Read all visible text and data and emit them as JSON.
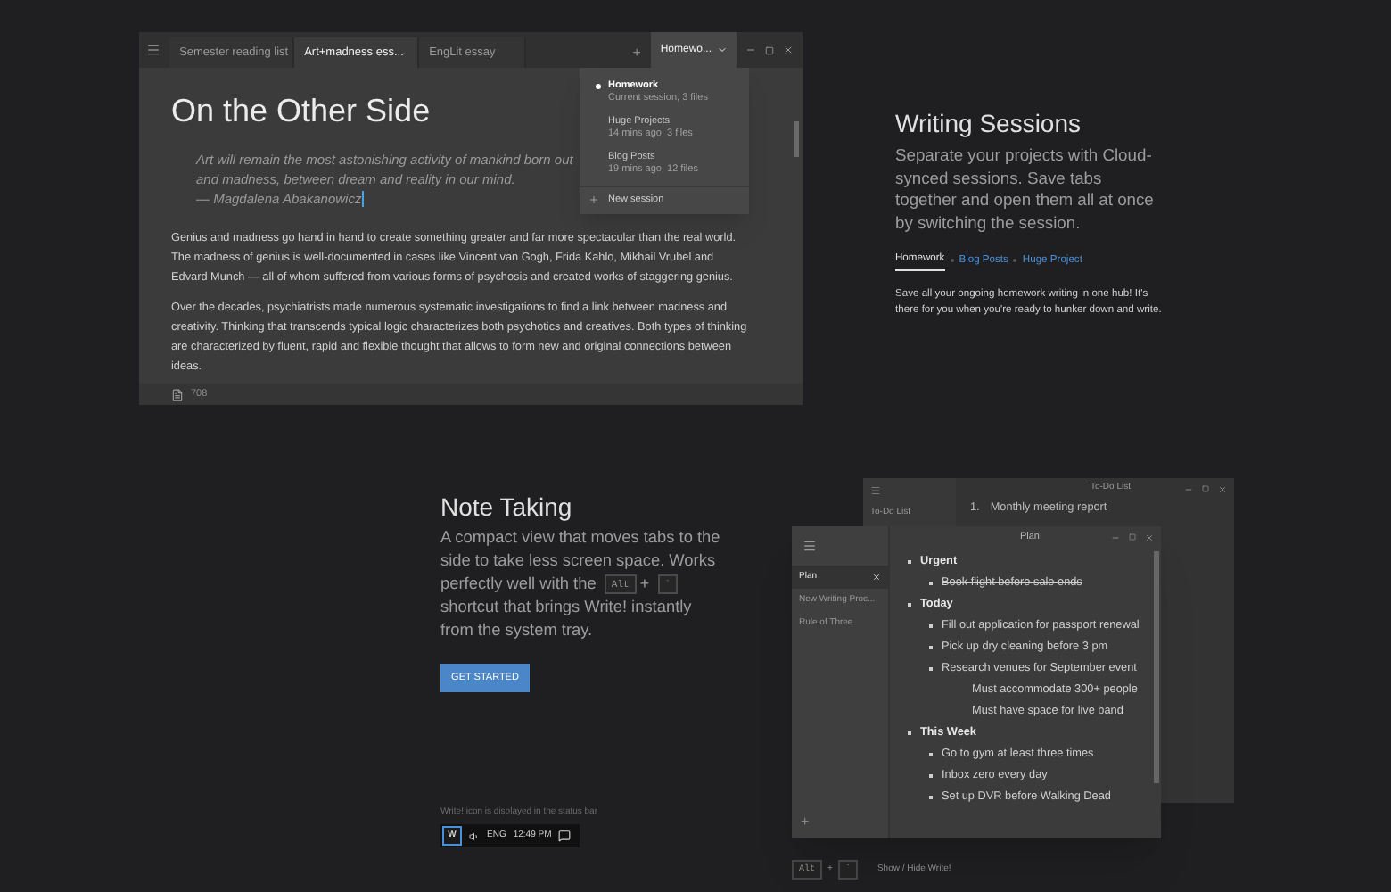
{
  "editor": {
    "tabs": [
      {
        "label": "Semester reading list",
        "selected": false
      },
      {
        "label": "Art+madness ess...",
        "selected": true
      },
      {
        "label": "EngLit essay",
        "selected": false
      }
    ],
    "new_tab": "+",
    "session_button": "Homewo...",
    "session_menu": {
      "items": [
        {
          "name": "Homework",
          "detail": "Current session, 3 files",
          "selected": true
        },
        {
          "name": "Huge Projects",
          "detail": "14 mins ago, 3 files",
          "selected": false
        },
        {
          "name": "Blog Posts",
          "detail": "19 mins ago, 12 files",
          "selected": false
        }
      ],
      "new_session": "New session"
    },
    "document": {
      "title": "On the Other Side",
      "quote_lines": [
        "Art will remain the most astonishing activity of mankind born out",
        "and madness, between dream and reality in our mind.",
        "— Magdalena Abakanowicz"
      ],
      "paragraphs": [
        "Genius and madness go hand in hand to create something greater and far more spectacular than the real world. The madness of genius is well-documented in cases like Vincent van Gogh, Frida Kahlo, Mikhail Vrubel and Edvard Munch — all of whom suffered from various forms of psychosis and created works of staggering genius.",
        "Over the decades, psychiatrists made numerous systematic investigations to find a link between madness and creativity. Thinking that transcends typical logic characterizes both psychotics and creatives. Both types of thinking are characterized by fluent, rapid and flexible thought that allows to form new and original connections between ideas."
      ]
    },
    "word_count": "708"
  },
  "sessions": {
    "title": "Writing Sessions",
    "description": "Separate your projects with Cloud-synced sessions. Save tabs together and open them all at once by switching the session.",
    "links": [
      {
        "label": "Homework",
        "selected": true
      },
      {
        "label": "Blog Posts",
        "selected": false
      },
      {
        "label": "Huge Project",
        "selected": false
      }
    ],
    "detail": "Save all your ongoing homework writing in one hub! It's there for you when you're ready to hunker down and write."
  },
  "notes": {
    "title": "Note Taking",
    "description": [
      {
        "kind": "text",
        "text": "A compact view that moves tabs to the side to take less screen space. Works perfectly well with the"
      },
      {
        "kind": "key",
        "text": "Alt"
      },
      {
        "kind": "text",
        "text": "+"
      },
      {
        "kind": "key",
        "text": "`"
      },
      {
        "kind": "text",
        "text": "shortcut that brings Write! instantly from the system tray."
      }
    ],
    "button": "GET STARTED",
    "caption": "Write! icon is displayed in the status bar",
    "taskbar": {
      "app_icon": "W",
      "language": "ENG",
      "time": "12:49 PM"
    }
  },
  "back_window": {
    "title": "To-Do List",
    "tab": "To-Do List",
    "items": [
      {
        "number": "1.",
        "text": "Monthly meeting report"
      }
    ]
  },
  "front_window": {
    "title": "Plan",
    "tabs": [
      {
        "label": "Plan",
        "selected": true
      },
      {
        "label": "New Writing Proc...",
        "selected": false
      },
      {
        "label": "Rule of Three",
        "selected": false
      }
    ],
    "outline": [
      {
        "text": "Urgent",
        "done": false,
        "children": [
          {
            "text": "Book flight before sale ends",
            "done": true
          }
        ]
      },
      {
        "text": "Today",
        "done": false,
        "children": [
          {
            "text": "Fill out application for passport renewal",
            "done": false
          },
          {
            "text": "Pick up dry cleaning before 3 pm",
            "done": false
          },
          {
            "text": "Research venues for September event",
            "done": false,
            "children": [
              {
                "text": "Must accommodate 300+ people",
                "done": false
              },
              {
                "text": "Must have space for live band",
                "done": false
              }
            ]
          }
        ]
      },
      {
        "text": "This Week",
        "done": false,
        "children": [
          {
            "text": "Go to gym at least three times",
            "done": false
          },
          {
            "text": "Inbox zero every day",
            "done": false
          },
          {
            "text": "Set up DVR before Walking Dead",
            "done": false
          }
        ]
      }
    ],
    "add": "+"
  },
  "shortcut": {
    "keys": [
      "Alt",
      "`"
    ],
    "plus": "+",
    "label": "Show / Hide Write!"
  }
}
